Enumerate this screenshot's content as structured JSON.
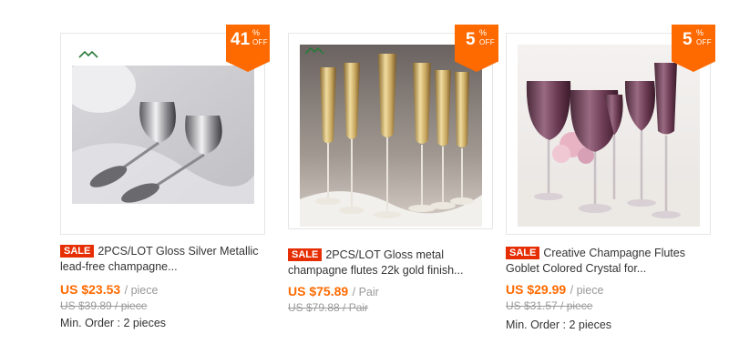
{
  "products": [
    {
      "discount": {
        "number": "41",
        "percent": "%",
        "off": "OFF"
      },
      "sale_label": "SALE",
      "title": "2PCS/LOT Gloss Silver Metallic lead-free champagne...",
      "price": "US $23.53",
      "unit": "/ piece",
      "original_price": "US $39.89 / piece",
      "min_order": "Min. Order : 2 pieces"
    },
    {
      "discount": {
        "number": "5",
        "percent": "%",
        "off": "OFF"
      },
      "sale_label": "SALE",
      "title": "2PCS/LOT Gloss metal champagne flutes 22k gold finish...",
      "price": "US $75.89",
      "unit": "/ Pair",
      "original_price": "US $79.88 / Pair",
      "min_order": ""
    },
    {
      "discount": {
        "number": "5",
        "percent": "%",
        "off": "OFF"
      },
      "sale_label": "SALE",
      "title": "Creative Champagne Flutes Goblet Colored Crystal for...",
      "price": "US $29.99",
      "unit": "/ piece",
      "original_price": "US $31.57 / piece",
      "min_order": "Min. Order : 2 pieces"
    }
  ],
  "colors": {
    "badge": "#ff6a00",
    "sale": "#e62e04",
    "price": "#ff6a00"
  }
}
